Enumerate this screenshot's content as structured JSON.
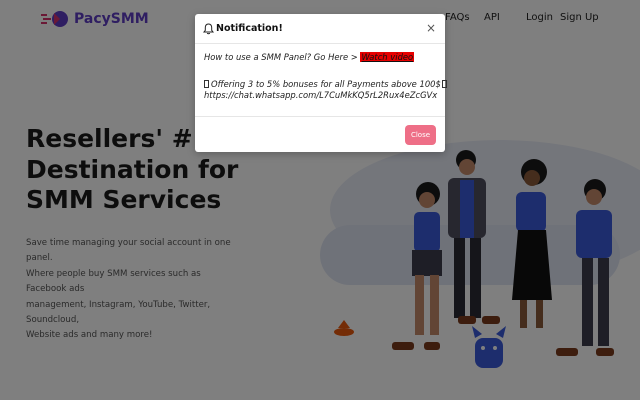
{
  "brand": {
    "name": "PacySMM",
    "accent": "#5f3dc4",
    "logo_red": "#d6336c"
  },
  "nav": {
    "faqs": "FAQs",
    "api": "API",
    "login": "Login",
    "signup": "Sign Up"
  },
  "hero": {
    "title_lines": [
      "Resellers' #",
      "Destination for",
      "SMM Services"
    ],
    "description_lines": [
      "Save time managing your social account in one panel.",
      "Where people buy SMM services such as Facebook ads",
      "management, Instagram, YouTube, Twitter, Soundcloud,",
      "Website ads and many more!"
    ]
  },
  "modal": {
    "icon": "bell-icon",
    "title": "Notification!",
    "close_icon": "close-icon",
    "line1_text": "How to use a SMM Panel? Go Here > ",
    "watch_video": "Watch video",
    "offer_text": "Offering 3 to 5% bonuses for all Payments above 100$",
    "whatsapp_link": "https://chat.whatsapp.com/L7CuMkKQ5rL2Rux4eZcGVx",
    "close_button": "Close",
    "close_button_color": "#ee6f87",
    "highlight_color": "#e60000"
  }
}
